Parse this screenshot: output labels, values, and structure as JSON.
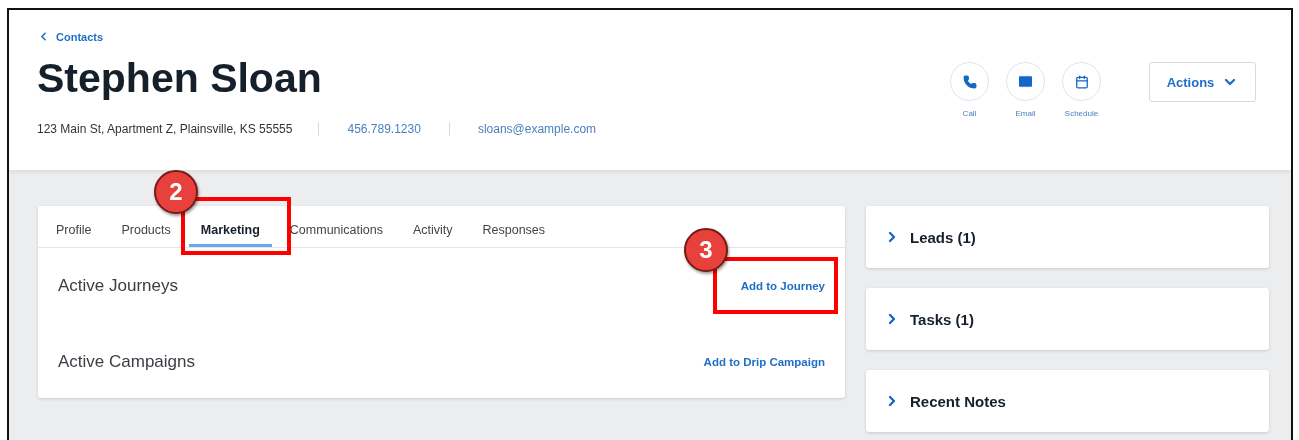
{
  "header": {
    "back_link": "Contacts",
    "name": "Stephen Sloan",
    "address": "123 Main St, Apartment Z, Plainsville, KS 55555",
    "phone": "456.789.1230",
    "email": "sloans@example.com",
    "quick_actions": [
      {
        "kind": "call",
        "label": "Call"
      },
      {
        "kind": "email",
        "label": "Email"
      },
      {
        "kind": "schedule",
        "label": "Schedule"
      }
    ],
    "actions_button": "Actions"
  },
  "tabs": [
    {
      "label": "Profile",
      "selected": false
    },
    {
      "label": "Products",
      "selected": false
    },
    {
      "label": "Marketing",
      "selected": true
    },
    {
      "label": "Communications",
      "selected": false
    },
    {
      "label": "Activity",
      "selected": false
    },
    {
      "label": "Responses",
      "selected": false
    }
  ],
  "sections": [
    {
      "title": "Active Journeys",
      "action": "Add to Journey"
    },
    {
      "title": "Active Campaigns",
      "action": "Add to Drip Campaign"
    }
  ],
  "side_panels": [
    {
      "title": "Leads (1)",
      "expanded": false
    },
    {
      "title": "Tasks (1)",
      "expanded": false
    },
    {
      "title": "Recent Notes",
      "expanded": false
    }
  ],
  "callouts": [
    {
      "number": "2"
    },
    {
      "number": "3"
    }
  ]
}
